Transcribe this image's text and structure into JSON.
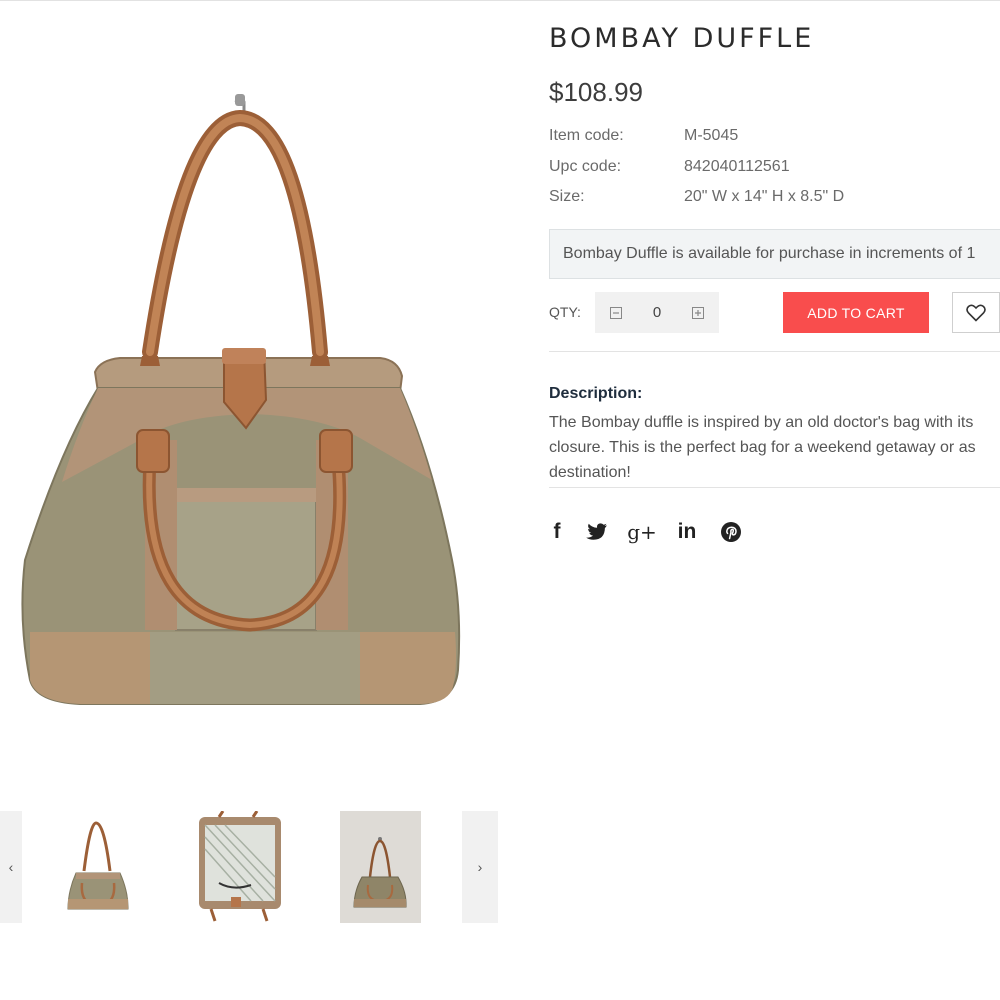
{
  "product": {
    "title": "BOMBAY DUFFLE",
    "price": "$108.99",
    "specs": [
      {
        "label": "Item code:",
        "value": "M-5045"
      },
      {
        "label": "Upc code:",
        "value": "842040112561"
      },
      {
        "label": "Size:",
        "value": "20\" W x 14\" H x 8.5\" D"
      }
    ],
    "notice": "Bombay Duffle is available for purchase in increments of 1"
  },
  "cart": {
    "qty_label": "QTY:",
    "qty_value": "0",
    "add_to_cart_label": "ADD TO CART"
  },
  "description": {
    "heading": "Description:",
    "lines": [
      "The Bombay duffle is inspired by an old doctor's bag with its",
      "closure. This is the perfect bag for a weekend getaway or as",
      "destination!"
    ]
  },
  "social": {
    "facebook": "f",
    "googleplus": "g+",
    "linkedin": "in"
  },
  "gallery": {
    "prev_arrow": "‹",
    "next_arrow": "›"
  },
  "colors": {
    "accent": "#f94d4d",
    "leather": "#b5754a",
    "canvas": "#9a9377",
    "suede": "#b29478"
  }
}
